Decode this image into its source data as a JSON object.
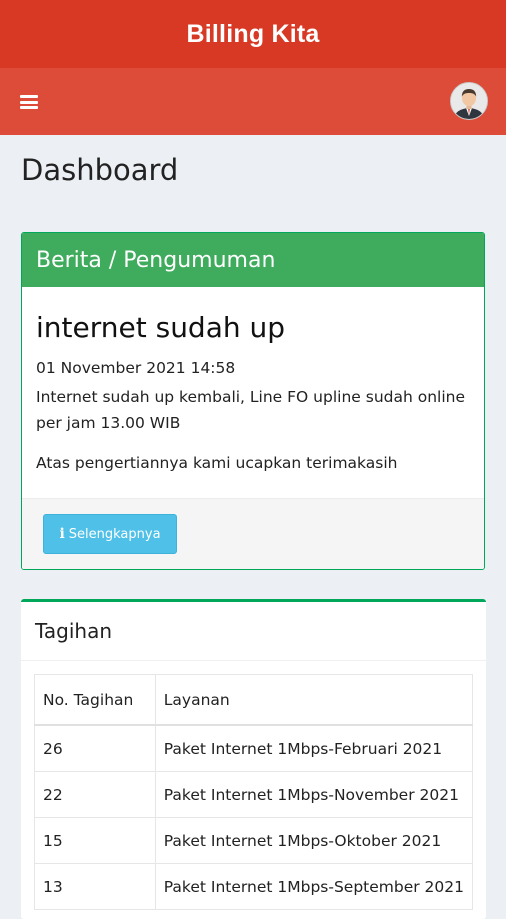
{
  "app": {
    "title": "Billing Kita"
  },
  "page": {
    "title": "Dashboard"
  },
  "news": {
    "header": "Berita / Pengumuman",
    "title": "internet sudah up",
    "date": "01 November 2021 14:58",
    "body": "Internet sudah up kembali, Line FO upline sudah online per jam 13.00 WIB",
    "thanks": "Atas pengertiannya kami ucapkan terimakasih",
    "more_button": "Selengkapnya",
    "more_icon": "info-icon"
  },
  "bills": {
    "header": "Tagihan",
    "columns": [
      "No. Tagihan",
      "Layanan"
    ],
    "rows": [
      [
        "26",
        "Paket Internet 1Mbps-Februari 2021"
      ],
      [
        "22",
        "Paket Internet 1Mbps-November 2021"
      ],
      [
        "15",
        "Paket Internet 1Mbps-Oktober 2021"
      ],
      [
        "13",
        "Paket Internet 1Mbps-September 2021"
      ]
    ]
  },
  "colors": {
    "appbar": "#d73925",
    "navbar": "#dd4b39",
    "news_header": "#3fab5c",
    "button": "#4fc0e8",
    "background": "#ecf0f5"
  }
}
